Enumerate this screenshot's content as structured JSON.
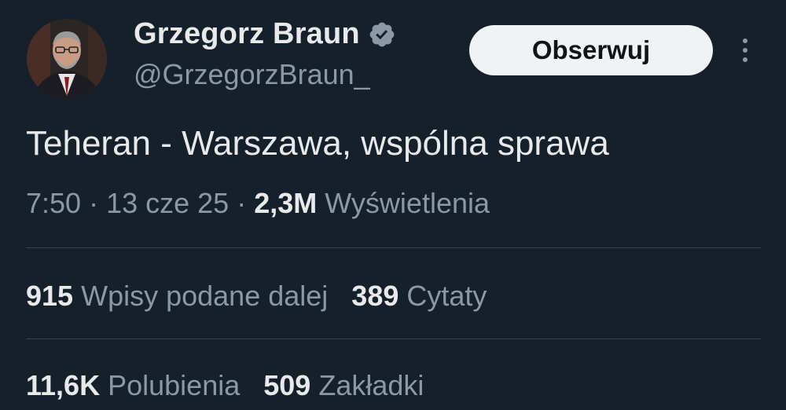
{
  "author": {
    "name": "Grzegorz Braun",
    "handle": "@GrzegorzBraun_",
    "verified": true,
    "verified_color": "#8b98a5"
  },
  "follow_button": {
    "label": "Obserwuj"
  },
  "tweet": {
    "text": "Teheran - Warszawa, wspólna sprawa",
    "time": "7:50",
    "separator": " · ",
    "date": "13 cze 25",
    "views_count": "2,3M",
    "views_label": "Wyświetlenia"
  },
  "stats": {
    "retweets": {
      "count": "915",
      "label": "Wpisy podane dalej"
    },
    "quotes": {
      "count": "389",
      "label": "Cytaty"
    },
    "likes": {
      "count": "11,6K",
      "label": "Polubienia"
    },
    "bookmarks": {
      "count": "509",
      "label": "Zakładki"
    }
  },
  "theme": {
    "background": "#15202b",
    "text_primary": "#e7e9ea",
    "text_secondary": "#8b98a5",
    "divider": "#38444d"
  },
  "icons": [
    "avatar-image",
    "verified-badge-icon",
    "more-options-icon"
  ]
}
